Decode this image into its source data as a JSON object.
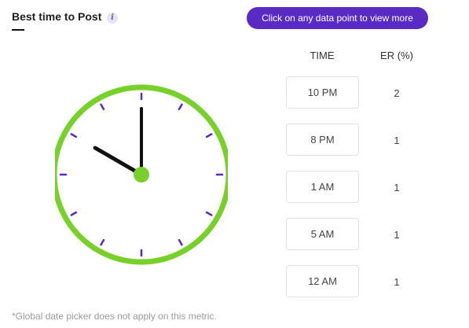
{
  "header": {
    "title": "Best time to Post",
    "info_icon": "info-icon",
    "cta_label": "Click on any data point to view more"
  },
  "table": {
    "headers": [
      "TIME",
      "ER (%)"
    ],
    "rows": [
      {
        "time": "10 PM",
        "er": "2"
      },
      {
        "time": "8 PM",
        "er": "1"
      },
      {
        "time": "1 AM",
        "er": "1"
      },
      {
        "time": "5 AM",
        "er": "1"
      },
      {
        "time": "12 AM",
        "er": "1"
      }
    ]
  },
  "clock": {
    "hours": 10,
    "minutes": 0
  },
  "footnote": "*Global date picker does not apply on this metric.",
  "colors": {
    "accent": "#5a2bc4",
    "clock_ring": "#78d12a",
    "tick": "#5a2bc4",
    "hand": "#111111"
  }
}
